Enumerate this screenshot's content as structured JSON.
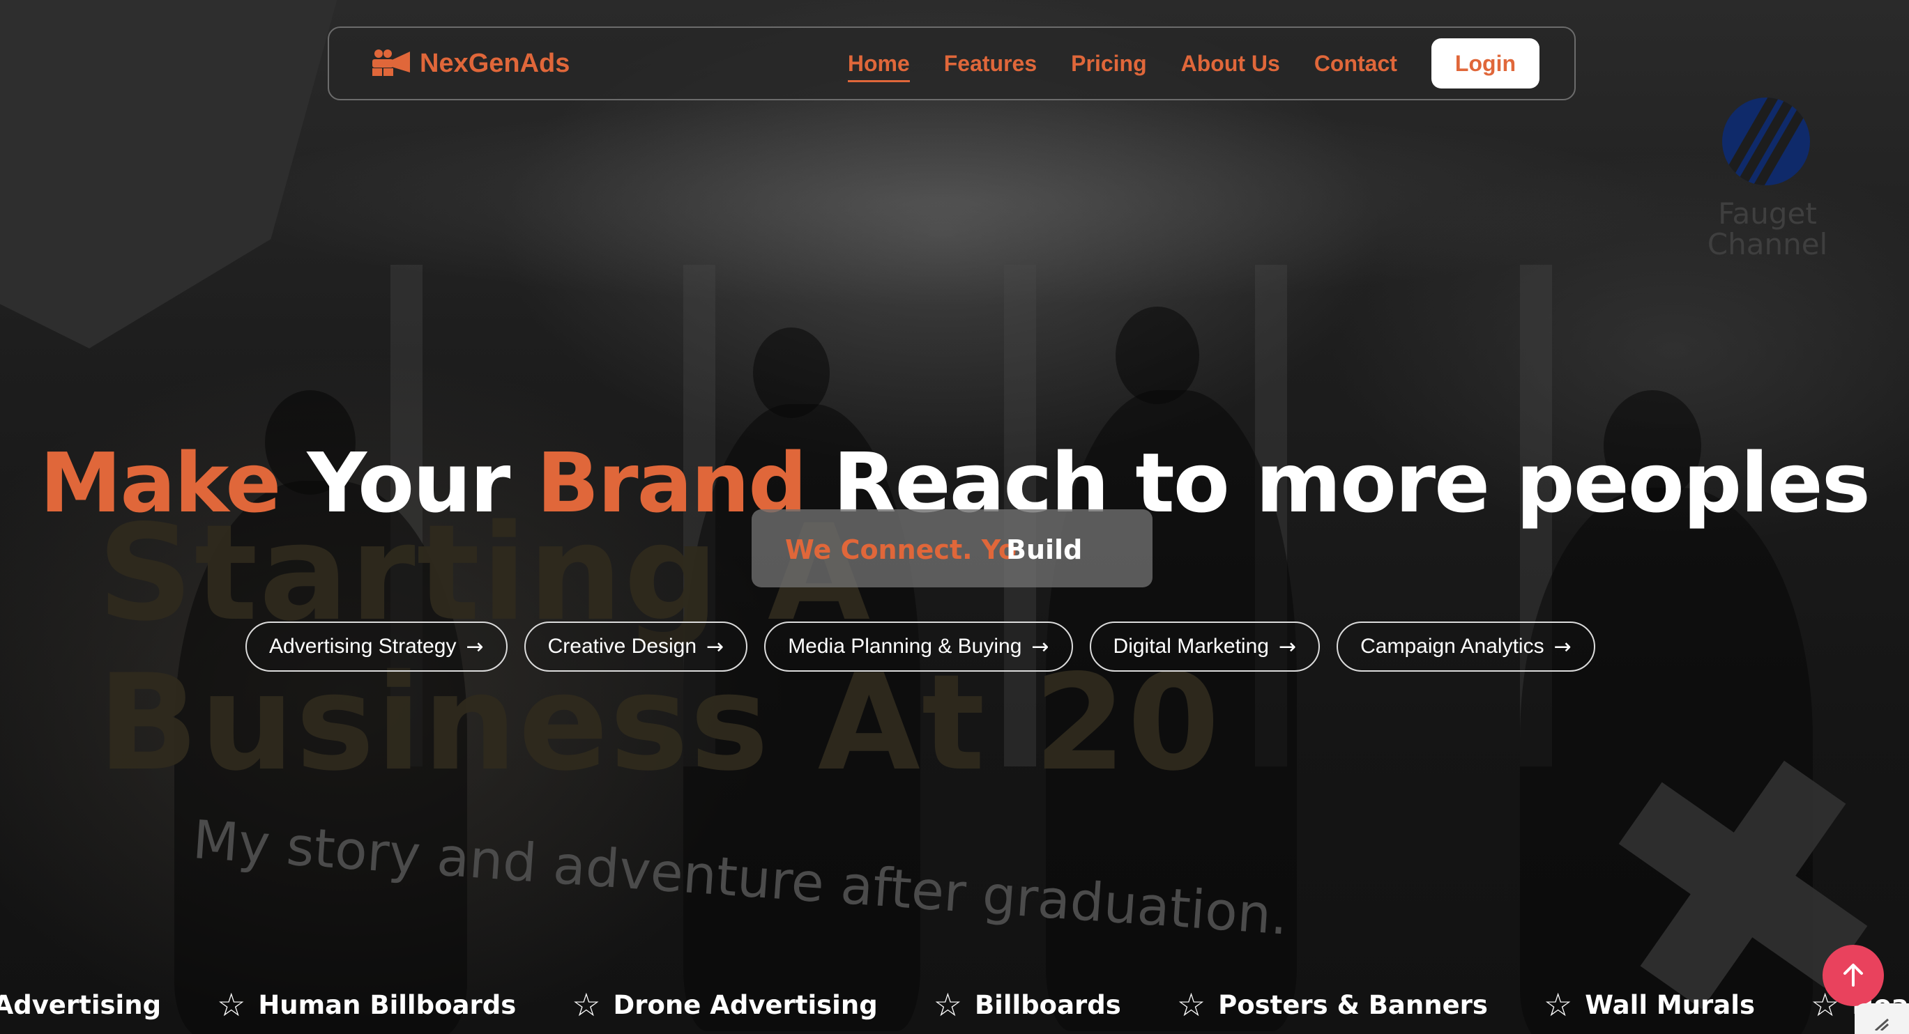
{
  "navbar": {
    "brand": "NexGenAds",
    "links": [
      "Home",
      "Features",
      "Pricing",
      "About Us",
      "Contact"
    ],
    "active_link": "Home",
    "login_label": "Login"
  },
  "hero": {
    "title_words": [
      "Make",
      "Your",
      "Brand",
      "Reach to more peoples"
    ],
    "typing_text_a": "We Connect. Yo",
    "typing_text_b": "Build"
  },
  "services": [
    "Advertising Strategy",
    "Creative Design",
    "Media Planning & Buying",
    "Digital Marketing",
    "Campaign Analytics"
  ],
  "service_arrow": "→",
  "marquee": [
    "t Advertising",
    "Human Billboards",
    "Drone Advertising",
    "Billboards",
    "Posters & Banners",
    "Wall Murals",
    "Hoardin"
  ],
  "background": {
    "watermark_brand": "Fauget Channel",
    "watermark_title_line1": "Starting A",
    "watermark_title_line2": "Business At 20",
    "watermark_subtitle": "My story and adventure after graduation."
  },
  "colors": {
    "accent": "#e0673a",
    "scroll_top_button": "#e9425d",
    "text": "#ffffff"
  },
  "icons": {
    "brand": "megaphone-icon",
    "marquee": "star-outline-icon",
    "scroll_top": "arrow-up-icon"
  }
}
